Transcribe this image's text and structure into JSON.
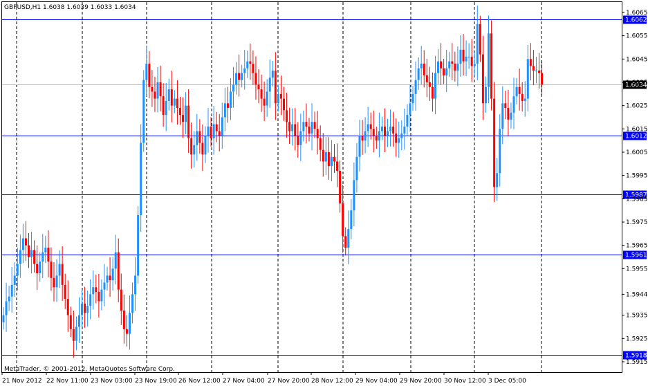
{
  "header": {
    "symbol_line": "GBPUSD,H1  1.6038 1.6039 1.6033 1.6034"
  },
  "footer": {
    "copyright": "MetaTrader, © 2001-2012, MetaQuotes Software Corp."
  },
  "colors": {
    "bull": "#1e90ff",
    "bear": "#ff0000",
    "level_line": "#0000ff",
    "current_line": "#c0c0c0",
    "grid": "#000000"
  },
  "chart_data": {
    "type": "candlestick",
    "title": "GBPUSD,H1",
    "ohlc_header": {
      "open": 1.6038,
      "high": 1.6039,
      "low": 1.6033,
      "close": 1.6034
    },
    "ylim": [
      1.5912,
      1.6068
    ],
    "y_ticks": [
      "1.6065",
      "1.6055",
      "1.6045",
      "1.6035",
      "1.6025",
      "1.6015",
      "1.6005",
      "1.5995",
      "1.5985",
      "1.5975",
      "1.5965",
      "1.5955",
      "1.5944",
      "1.5935",
      "1.5925",
      "1.5915"
    ],
    "x_ticks": [
      "21 Nov 2012",
      "22 Nov 11:00",
      "23 Nov 03:00",
      "23 Nov 19:00",
      "26 Nov 12:00",
      "27 Nov 04:00",
      "27 Nov 20:00",
      "28 Nov 12:00",
      "29 Nov 04:00",
      "29 Nov 20:00",
      "30 Nov 12:00",
      "3 Dec 05:00"
    ],
    "grid": "vertical dashed",
    "current_price": "1.6034",
    "levels": [
      "1.6062",
      "1.6012",
      "1.5987",
      "1.5961",
      "1.5918"
    ],
    "closes": [
      1.5935,
      1.5941,
      1.5943,
      1.5948,
      1.5952,
      1.5957,
      1.5963,
      1.5968,
      1.5965,
      1.596,
      1.5963,
      1.5957,
      1.5953,
      1.5958,
      1.5962,
      1.5964,
      1.5958,
      1.5951,
      1.5947,
      1.5952,
      1.5957,
      1.5948,
      1.5942,
      1.5935,
      1.5929,
      1.5924,
      1.593,
      1.5935,
      1.594,
      1.5936,
      1.5939,
      1.5944,
      1.5947,
      1.5945,
      1.5941,
      1.5946,
      1.5949,
      1.5952,
      1.595,
      1.5955,
      1.5962,
      1.5946,
      1.5937,
      1.5929,
      1.5927,
      1.5936,
      1.5944,
      1.5952,
      1.5978,
      1.6009,
      1.6036,
      1.6043,
      1.6033,
      1.6031,
      1.6028,
      1.6035,
      1.6029,
      1.6021,
      1.6027,
      1.6032,
      1.6025,
      1.6028,
      1.6024,
      1.6021,
      1.6018,
      1.6025,
      1.6011,
      1.6004,
      1.6008,
      1.6014,
      1.6009,
      1.6004,
      1.6012,
      1.6016,
      1.6011,
      1.6017,
      1.6014,
      1.6012,
      1.602,
      1.6026,
      1.6024,
      1.6031,
      1.6034,
      1.6039,
      1.6036,
      1.6039,
      1.6041,
      1.6044,
      1.6043,
      1.6039,
      1.6034,
      1.6032,
      1.6028,
      1.6025,
      1.6031,
      1.6037,
      1.604,
      1.6026,
      1.603,
      1.6028,
      1.6023,
      1.6018,
      1.6014,
      1.6017,
      1.6012,
      1.6008,
      1.6014,
      1.6018,
      1.6016,
      1.6013,
      1.6018,
      1.6015,
      1.6011,
      1.6006,
      1.6001,
      1.6005,
      1.5999,
      1.6003,
      1.6001,
      1.5997,
      1.5983,
      1.5969,
      1.5964,
      1.5972,
      1.598,
      1.5993,
      1.6003,
      1.6012,
      1.601,
      1.6014,
      1.6017,
      1.6015,
      1.6012,
      1.601,
      1.6014,
      1.6016,
      1.6012,
      1.6014,
      1.6016,
      1.6013,
      1.6009,
      1.6011,
      1.6013,
      1.6016,
      1.6021,
      1.6026,
      1.603,
      1.6036,
      1.6041,
      1.6043,
      1.6038,
      1.6035,
      1.6033,
      1.6028,
      1.6039,
      1.6044,
      1.6041,
      1.6038,
      1.6041,
      1.6044,
      1.6043,
      1.604,
      1.6043,
      1.6049,
      1.6044,
      1.6046,
      1.6046,
      1.6042,
      1.6043,
      1.606,
      1.6047,
      1.6026,
      1.6033,
      1.6056,
      1.6028,
      1.599,
      1.5996,
      1.6015,
      1.6026,
      1.6024,
      1.6019,
      1.6022,
      1.6029,
      1.6033,
      1.603,
      1.6027,
      1.6028,
      1.6045,
      1.6042,
      1.604,
      1.604,
      1.6039,
      1.6034
    ]
  }
}
